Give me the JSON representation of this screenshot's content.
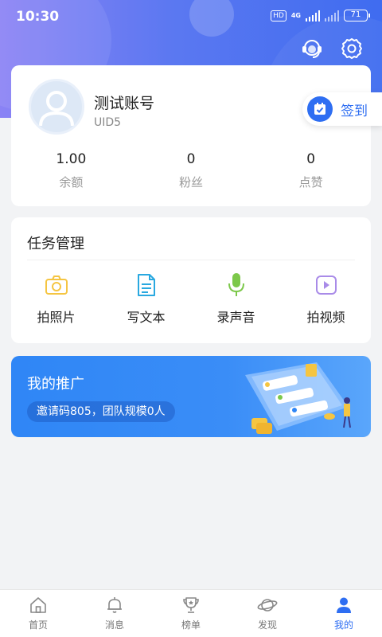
{
  "status_bar": {
    "time": "10:30",
    "hd": "HD",
    "network": "4G",
    "battery": "71"
  },
  "header": {
    "icons": [
      "customer-service-icon",
      "settings-gear-icon"
    ]
  },
  "profile": {
    "name": "测试账号",
    "uid": "UID5",
    "signin_label": "签到",
    "stats": [
      {
        "value": "1.00",
        "label": "余额"
      },
      {
        "value": "0",
        "label": "粉丝"
      },
      {
        "value": "0",
        "label": "点赞"
      }
    ]
  },
  "tasks": {
    "title": "任务管理",
    "items": [
      {
        "label": "拍照片",
        "icon": "camera-icon",
        "color": "#f5c542"
      },
      {
        "label": "写文本",
        "icon": "document-icon",
        "color": "#29a8e0"
      },
      {
        "label": "录声音",
        "icon": "microphone-icon",
        "color": "#7cc84a"
      },
      {
        "label": "拍视频",
        "icon": "video-play-icon",
        "color": "#a98be8"
      }
    ]
  },
  "promo": {
    "title": "我的推广",
    "subtitle": "邀请码805，团队规模0人"
  },
  "bottom_nav": {
    "items": [
      {
        "label": "首页",
        "icon": "home-icon"
      },
      {
        "label": "消息",
        "icon": "bell-icon"
      },
      {
        "label": "榜单",
        "icon": "trophy-icon"
      },
      {
        "label": "发现",
        "icon": "planet-icon"
      },
      {
        "label": "我的",
        "icon": "user-icon"
      }
    ],
    "active_index": 4
  },
  "colors": {
    "accent": "#2e6ef2",
    "header_gradient_start": "#8a82f5",
    "header_gradient_end": "#3f6cf0",
    "promo": "#2f86f6"
  }
}
